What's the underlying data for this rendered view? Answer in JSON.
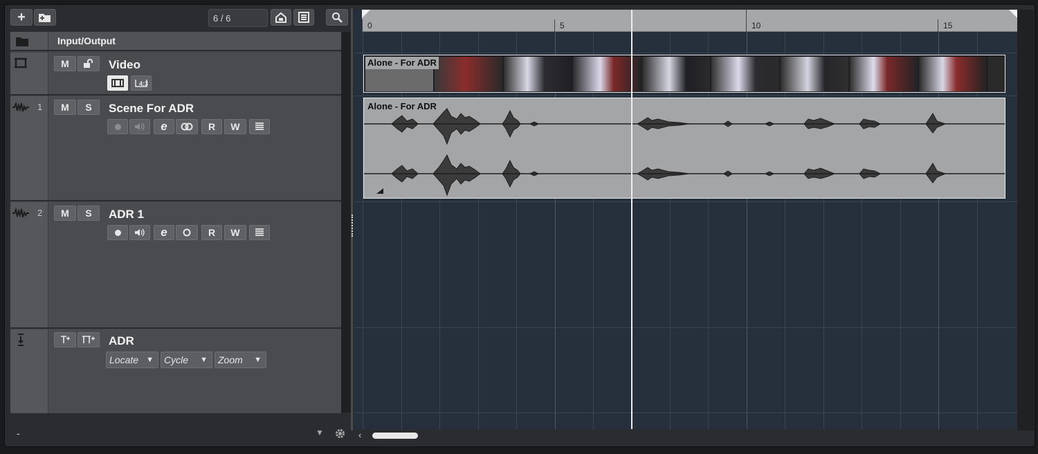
{
  "toolbar": {
    "counter": "6 / 6"
  },
  "inspector_header": {
    "label": "Input/Output"
  },
  "tracks": {
    "video": {
      "name": "Video",
      "mute": "M"
    },
    "t1": {
      "number": "1",
      "name": "Scene For ADR",
      "mute": "M",
      "solo": "S",
      "read": "R",
      "write": "W"
    },
    "t2": {
      "number": "2",
      "name": "ADR 1",
      "mute": "M",
      "solo": "S",
      "read": "R",
      "write": "W"
    },
    "marker": {
      "name": "ADR",
      "locate": "Locate",
      "cycle": "Cycle",
      "zoom": "Zoom"
    }
  },
  "footer": {
    "left_text": "-"
  },
  "ruler": {
    "ticks": [
      "0",
      "5",
      "10",
      "15"
    ]
  },
  "events": {
    "video_title": "Alone - For ADR",
    "audio_title": "Alone - For ADR"
  },
  "colors": {
    "timeline_bg": "#26303c",
    "event_bg": "#a4a5a7",
    "waveform": "#2a2a2a"
  }
}
